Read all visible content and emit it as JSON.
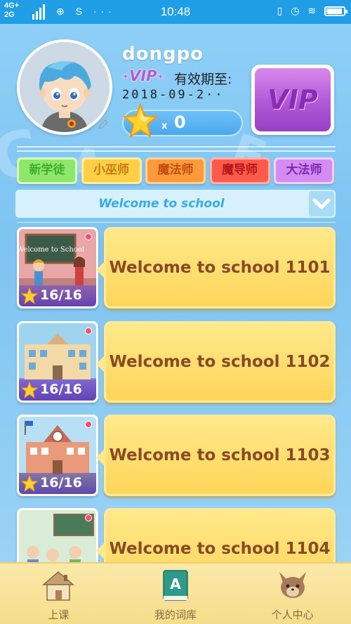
{
  "status_bar": {
    "network_top": "4G+",
    "network_bottom": "2G",
    "app_icons": "⊕ S ···",
    "time": "10:48",
    "right_icons": "▯ ◷ ≋"
  },
  "profile": {
    "username": "dongpo",
    "vip_label": "VIP",
    "validity_label": "有效期至:",
    "expiry_date": "2018-09-2··",
    "star_multiplier": "x",
    "star_count": "0",
    "vip_button_label": "VIP"
  },
  "levels": [
    {
      "label": "新学徒",
      "color": "#3fae2e",
      "bg": "#8ee66a",
      "border": "#d8ffb8"
    },
    {
      "label": "小巫师",
      "color": "#c77a10",
      "bg": "#ffcf45",
      "border": "#ffeca0"
    },
    {
      "label": "魔法师",
      "color": "#c24a12",
      "bg": "#ff9a3a",
      "border": "#ffd096"
    },
    {
      "label": "魔导师",
      "color": "#b01818",
      "bg": "#ff5a4a",
      "border": "#ffb0a8"
    },
    {
      "label": "大法师",
      "color": "#7a26b0",
      "bg": "#d48cf2",
      "border": "#f2d0ff"
    }
  ],
  "dropdown": {
    "selected": "Welcome to school"
  },
  "lessons": [
    {
      "title": "Welcome to school 1101",
      "progress": "16/16",
      "scene": "classroom",
      "board_text": "Welcome to School"
    },
    {
      "title": "Welcome to school 1102",
      "progress": "16/16",
      "scene": "school-building",
      "board_text": ""
    },
    {
      "title": "Welcome to school 1103",
      "progress": "16/16",
      "scene": "clock-school",
      "board_text": ""
    },
    {
      "title": "Welcome to school 1104",
      "progress": "",
      "scene": "students",
      "board_text": ""
    }
  ],
  "bottom_nav": [
    {
      "label": "上课",
      "icon": "house-icon"
    },
    {
      "label": "我的词库",
      "icon": "book-icon"
    },
    {
      "label": "个人中心",
      "icon": "cat-face-icon"
    }
  ],
  "colors": {
    "status_bar": "#1f9ee6",
    "background": "#8fd0f6",
    "card_fill": "#ffd55a",
    "card_text": "#8a4a24",
    "dropdown_text": "#3aaae0"
  }
}
